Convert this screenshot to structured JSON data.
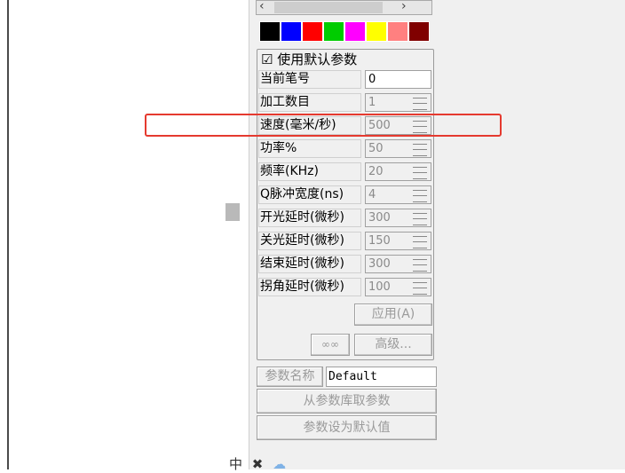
{
  "scrollbar": {
    "left_arrow": "‹",
    "right_arrow": "›"
  },
  "pen_colors": [
    "#000000",
    "#0000ff",
    "#ff0000",
    "#00cc00",
    "#ff00ff",
    "#ffff00",
    "#ff8080",
    "#800000"
  ],
  "use_default": {
    "checked": true,
    "check_mark": "☑",
    "label": "使用默认参数"
  },
  "params": [
    {
      "label": "当前笔号",
      "value": "0",
      "disabled": false,
      "spinner": false
    },
    {
      "label": "加工数目",
      "value": "1",
      "disabled": true,
      "spinner": true
    },
    {
      "label": "速度(毫米/秒)",
      "value": "500",
      "disabled": true,
      "spinner": true
    },
    {
      "label": "功率%",
      "value": "50",
      "disabled": true,
      "spinner": true
    },
    {
      "label": "频率(KHz)",
      "value": "20",
      "disabled": true,
      "spinner": true
    },
    {
      "label": "Q脉冲宽度(ns)",
      "value": "4",
      "disabled": true,
      "spinner": true
    },
    {
      "label": "开光延时(微秒)",
      "value": "300",
      "disabled": true,
      "spinner": true
    },
    {
      "label": "关光延时(微秒)",
      "value": "150",
      "disabled": true,
      "spinner": true
    },
    {
      "label": "结束延时(微秒)",
      "value": "300",
      "disabled": true,
      "spinner": true
    },
    {
      "label": "拐角延时(微秒)",
      "value": "100",
      "disabled": true,
      "spinner": true
    }
  ],
  "buttons": {
    "apply": "应用(A)",
    "wobble": "∞∞",
    "advanced": "高级...",
    "param_name_label": "参数名称",
    "load_from_library": "从参数库取参数",
    "set_as_default": "参数设为默认值"
  },
  "param_name_value": "Default",
  "taskbar": {
    "ime_label": "中",
    "icon2": "✖",
    "icon3": "☁"
  },
  "colors": {
    "highlight": "#e53a2f",
    "panel_bg": "#f0f0f0"
  }
}
